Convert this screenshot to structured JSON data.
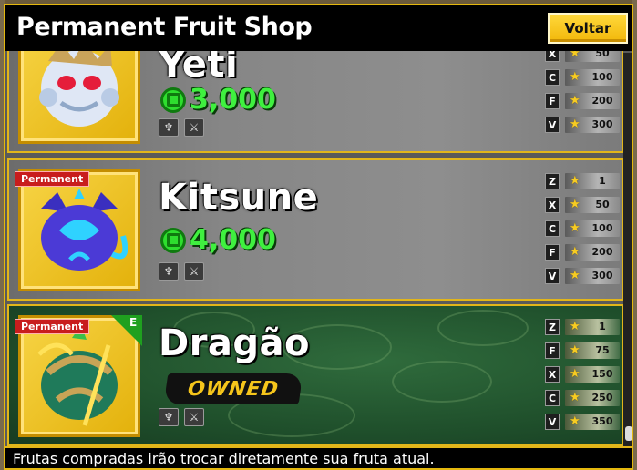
{
  "window": {
    "title": "Permanent Fruit Shop",
    "back_label": "Voltar",
    "footer_text": "Frutas compradas irão trocar diretamente sua fruta atual."
  },
  "fruits": [
    {
      "name": "Yeti",
      "price": "3,000",
      "moves": [
        {
          "key": "X",
          "level": "50"
        },
        {
          "key": "C",
          "level": "100"
        },
        {
          "key": "F",
          "level": "200"
        },
        {
          "key": "V",
          "level": "300"
        }
      ]
    },
    {
      "name": "Kitsune",
      "badge": "Permanent",
      "price": "4,000",
      "moves": [
        {
          "key": "Z",
          "level": "1"
        },
        {
          "key": "X",
          "level": "50"
        },
        {
          "key": "C",
          "level": "100"
        },
        {
          "key": "F",
          "level": "200"
        },
        {
          "key": "V",
          "level": "300"
        }
      ]
    },
    {
      "name": "Dragão",
      "badge": "Permanent",
      "corner_tag": "E",
      "status": "OWNED",
      "moves": [
        {
          "key": "Z",
          "level": "1"
        },
        {
          "key": "F",
          "level": "75"
        },
        {
          "key": "X",
          "level": "150"
        },
        {
          "key": "C",
          "level": "250"
        },
        {
          "key": "V",
          "level": "350"
        }
      ]
    }
  ],
  "colors": {
    "accent_gold": "#e2b61a",
    "price_green": "#3ff03f",
    "badge_red": "#c81d1d",
    "owned_yellow": "#f5c51b"
  },
  "icons": [
    "robux-icon",
    "star-icon",
    "fighting-style-icon",
    "sword-icon"
  ]
}
